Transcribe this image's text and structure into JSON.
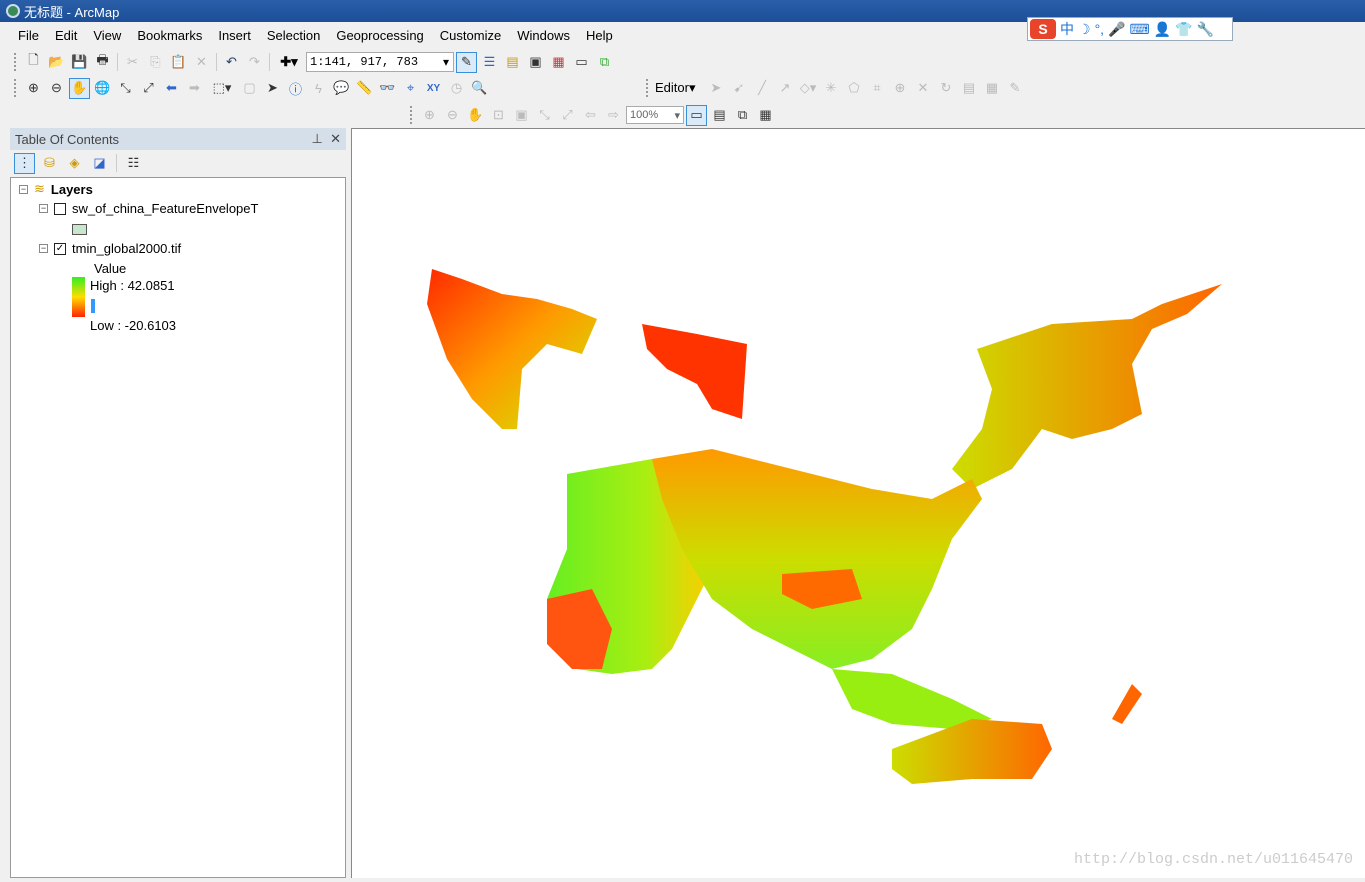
{
  "window": {
    "title": "无标题 - ArcMap"
  },
  "menu": [
    "File",
    "Edit",
    "View",
    "Bookmarks",
    "Insert",
    "Selection",
    "Geoprocessing",
    "Customize",
    "Windows",
    "Help"
  ],
  "ime": {
    "logo": "S",
    "mode": "中",
    "items": [
      "☽",
      "°,",
      "🎤",
      "⌨",
      "👤",
      "👕",
      "🔧"
    ]
  },
  "toolbar1": {
    "scale": "1:141, 917, 783"
  },
  "toolbar2": {
    "editor": "Editor▾"
  },
  "layout_toolbar": {
    "zoom": "100%"
  },
  "toc": {
    "title": "Table Of Contents",
    "pin": "⊥",
    "close": "✕",
    "root": "Layers",
    "layers": [
      {
        "name": "sw_of_china_FeatureEnvelopeT",
        "checked": false,
        "swatch": "#c8e6c9"
      },
      {
        "name": "tmin_global2000.tif",
        "checked": true,
        "legend_title": "Value",
        "high": "High : 42.0851",
        "low": "Low : -20.6103"
      }
    ]
  },
  "map": {
    "watermark": "http://blog.csdn.net/u011645470",
    "ramp": [
      "#ff2200",
      "#ffcc00",
      "#33ee22"
    ]
  }
}
